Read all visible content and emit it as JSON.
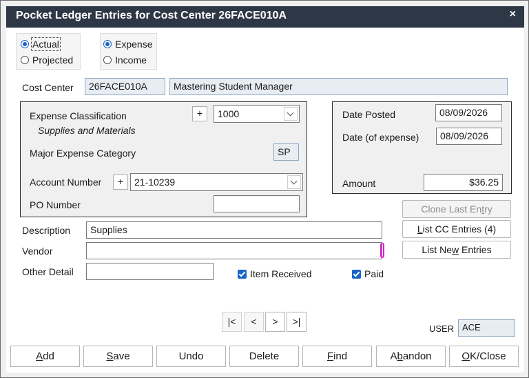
{
  "window": {
    "title": "Pocket Ledger Entries for Cost Center 26FACE010A",
    "close_glyph": "×"
  },
  "entry_type": {
    "actual": "Actual",
    "projected": "Projected",
    "selected": "Actual"
  },
  "flow_type": {
    "expense": "Expense",
    "income": "Income",
    "selected": "Expense"
  },
  "cost_center": {
    "label": "Cost Center",
    "code": "26FACE010A",
    "name": "Mastering Student Manager"
  },
  "classification": {
    "label": "Expense Classification",
    "value": "1000",
    "description": "Supplies and Materials",
    "plus": "+"
  },
  "major_category": {
    "label": "Major Expense Category",
    "value": "SP"
  },
  "account": {
    "label": "Account Number",
    "value": "21-10239",
    "plus": "+"
  },
  "po": {
    "label": "PO Number",
    "value": ""
  },
  "dates": {
    "posted_label": "Date Posted",
    "posted": "08/09/2026",
    "expense_label": "Date (of expense)",
    "expense": "08/09/2026"
  },
  "amount": {
    "label": "Amount",
    "value": "$36.25"
  },
  "side_buttons": {
    "clone": {
      "pre": "Clone Last En",
      "key": "t",
      "post": "ry"
    },
    "list_cc": {
      "pre": "",
      "key": "L",
      "post": "ist CC Entries (4)"
    },
    "list_new": {
      "pre": "List Ne",
      "key": "w",
      "post": " Entries"
    }
  },
  "description": {
    "label": "Description",
    "value": "Supplies"
  },
  "vendor": {
    "label": "Vendor",
    "value": ""
  },
  "other_detail": {
    "label": "Other Detail",
    "value": ""
  },
  "checks": {
    "item_received": "Item Received",
    "paid": "Paid"
  },
  "navigation": {
    "first": "|<",
    "prev": "<",
    "next": ">",
    "last": ">|"
  },
  "user": {
    "label": "USER",
    "value": "ACE"
  },
  "bottom_buttons": {
    "add": {
      "pre": "",
      "key": "A",
      "post": "dd"
    },
    "save": {
      "pre": "",
      "key": "S",
      "post": "ave"
    },
    "undo": {
      "pre": "Undo",
      "key": "",
      "post": ""
    },
    "delete": {
      "pre": "Delete",
      "key": "",
      "post": ""
    },
    "find": {
      "pre": "",
      "key": "F",
      "post": "ind"
    },
    "abandon": {
      "pre": "A",
      "key": "b",
      "post": "andon"
    },
    "ok_close": {
      "pre": "",
      "key": "O",
      "post": "K/Close"
    }
  },
  "colors": {
    "titlebar": "#2e3745",
    "accent": "#1a63c7",
    "readonly_field": "#e8edf3",
    "focus_caret": "#e01ed1"
  }
}
